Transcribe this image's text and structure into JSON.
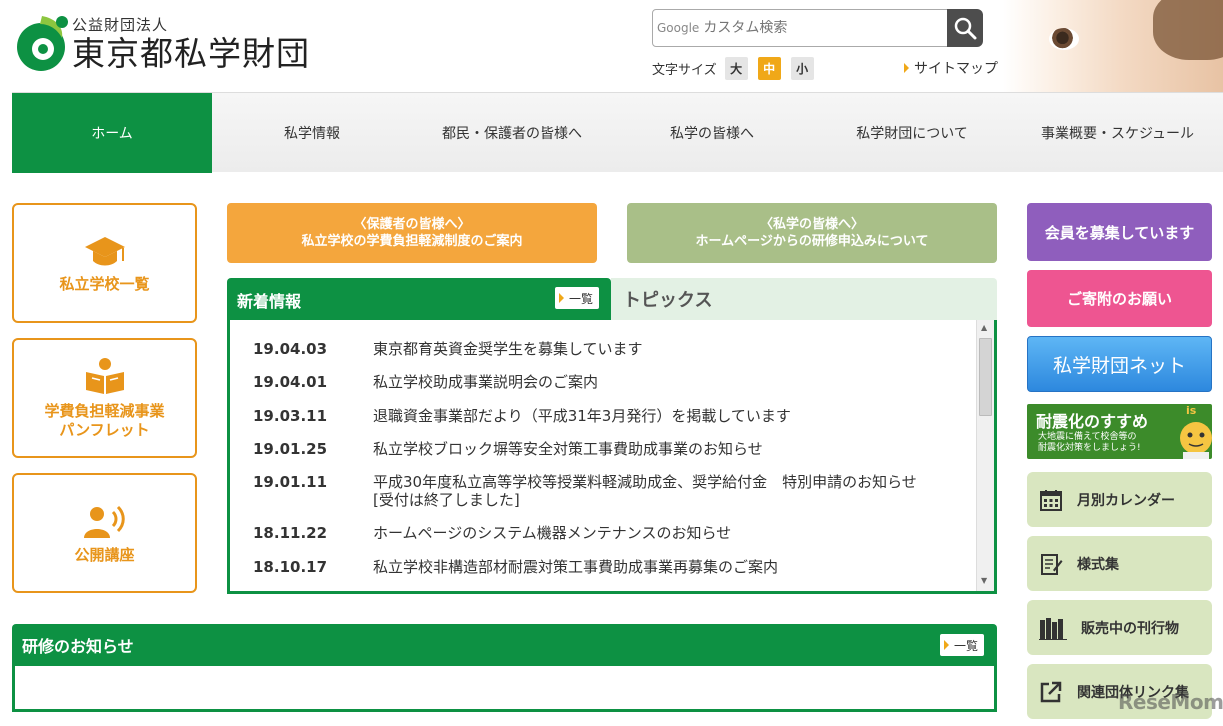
{
  "header": {
    "org_type": "公益財団法人",
    "org_name": "東京都私学財団",
    "search_provider": "Google",
    "search_placeholder": "カスタム検索",
    "font_size_label": "文字サイズ",
    "font_sizes": [
      "大",
      "中",
      "小"
    ],
    "font_size_selected": "中",
    "sitemap_label": "サイトマップ"
  },
  "nav": {
    "items": [
      "ホーム",
      "私学情報",
      "都民・保護者の皆様へ",
      "私学の皆様へ",
      "私学財団について",
      "事業概要・スケジュール"
    ],
    "active": "ホーム"
  },
  "left_cards": [
    {
      "label": "私立学校一覧",
      "icon": "graduation-cap-icon"
    },
    {
      "label": "学費負担軽減事業\nパンフレット",
      "icon": "pamphlet-reader-icon"
    },
    {
      "label": "公開講座",
      "icon": "speaker-person-icon"
    }
  ],
  "banners": {
    "parents_line1": "〈保護者の皆様へ〉",
    "parents_line2": "私立学校の学費負担軽減制度のご案内",
    "schools_line1": "〈私学の皆様へ〉",
    "schools_line2": "ホームページからの研修申込みについて"
  },
  "news": {
    "tab_label": "新着情報",
    "list_label": "一覧",
    "topics_label": "トピックス",
    "items": [
      {
        "date": "19.04.03",
        "title": "東京都育英資金奨学生を募集しています"
      },
      {
        "date": "19.04.01",
        "title": "私立学校助成事業説明会のご案内"
      },
      {
        "date": "19.03.11",
        "title": "退職資金事業部だより（平成31年3月発行）を掲載しています"
      },
      {
        "date": "19.01.25",
        "title": "私立学校ブロック塀等安全対策工事費助成事業のお知らせ"
      },
      {
        "date": "19.01.11",
        "title": "平成30年度私立高等学校等授業料軽減助成金、奨学給付金　特別申請のお知らせ\n[受付は終了しました]"
      },
      {
        "date": "18.11.22",
        "title": "ホームページのシステム機器メンテナンスのお知らせ"
      },
      {
        "date": "18.10.17",
        "title": "私立学校非構造部材耐震対策工事費助成事業再募集のご案内"
      }
    ]
  },
  "training": {
    "title": "研修のお知らせ",
    "list_label": "一覧"
  },
  "right": {
    "members": "会員を募集しています",
    "donation": "ご寄附のお願い",
    "network": "私学財団ネット",
    "quake_title": "耐震化のすすめ",
    "quake_sub_1": "大地震に備えて校舎等の",
    "quake_sub_2": "耐震化対策をしましょう!",
    "quake_badge": "is",
    "links": [
      {
        "label": "月別カレンダー",
        "icon": "calendar-icon"
      },
      {
        "label": "様式集",
        "icon": "form-edit-icon"
      },
      {
        "label": "販売中の刊行物",
        "icon": "books-icon"
      },
      {
        "label": "関連団体リンク集",
        "icon": "external-link-icon"
      }
    ]
  },
  "watermark": "ReseMom",
  "colors": {
    "brand_green": "#0d9143",
    "accent_orange": "#e8951b",
    "members_purple": "#8f5ebd",
    "donation_pink": "#ee5591",
    "link_bg": "#d9e6c0"
  }
}
